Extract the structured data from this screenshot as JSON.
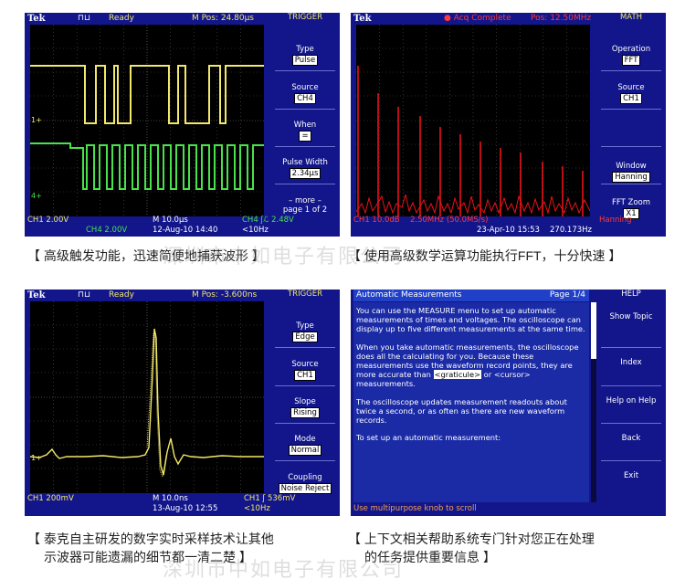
{
  "panels": {
    "trigger": {
      "brand": "Tek",
      "status": "Ready",
      "mpos": "M Pos: 24.80µs",
      "menu_title": "TRIGGER",
      "items": [
        {
          "label": "Type",
          "value": "Pulse"
        },
        {
          "label": "Source",
          "value": "CH4"
        },
        {
          "label": "When",
          "value": "="
        },
        {
          "label": "Pulse Width",
          "value": "2.34µs"
        },
        {
          "label": "– more –",
          "value": "page 1 of 2"
        }
      ],
      "readouts": {
        "ch1": "CH1  2.00V",
        "ch4": "CH4  2.00V",
        "time": "M 10.0µs",
        "date": "12-Aug-10 14:40",
        "trig": "CH4 ʃℒ 2.48V",
        "freq": "<10Hz"
      },
      "colors": {
        "ch1": "#f2e86a",
        "ch4": "#49e24a"
      }
    },
    "fft": {
      "brand": "Tek",
      "status": "Acq Complete",
      "pos": "Pos: 12.50MHz",
      "menu_title": "MATH",
      "items": [
        {
          "label": "Operation",
          "value": "FFT"
        },
        {
          "label": "Source",
          "value": "CH1"
        },
        {
          "label": "Window",
          "value": "Hanning"
        },
        {
          "label": "FFT Zoom",
          "value": "X1"
        }
      ],
      "readouts": {
        "scale": "CH1 10.0dB",
        "span": "2.50MHz (50.0MS/s)",
        "date": "23-Apr-10 15:53",
        "freq": "270.173Hz",
        "window": "Hanning"
      },
      "colors": {
        "math": "#e8121a"
      }
    },
    "edge": {
      "brand": "Tek",
      "status": "Ready",
      "mpos": "M Pos: -3.600ns",
      "menu_title": "TRIGGER",
      "items": [
        {
          "label": "Type",
          "value": "Edge"
        },
        {
          "label": "Source",
          "value": "CH1"
        },
        {
          "label": "Slope",
          "value": "Rising"
        },
        {
          "label": "Mode",
          "value": "Normal"
        },
        {
          "label": "Coupling",
          "value": "Noise Reject"
        }
      ],
      "readouts": {
        "ch1": "CH1  200mV",
        "time": "M 10.0ns",
        "date": "13-Aug-10 12:55",
        "trig": "CH1 ʃ 536mV",
        "freq": "<10Hz"
      }
    },
    "help": {
      "title": "Automatic Measurements",
      "page": "Page 1/4",
      "menu_title": "HELP",
      "items": [
        "Show Topic",
        "Index",
        "Help on Help",
        "Back",
        "Exit"
      ],
      "para1": "You can use the MEASURE menu to set up automatic measurements of times and voltages. The oscilloscope can display up to five different measurements at the same time.",
      "para2_a": "When you take automatic measurements, the oscilloscope does all the calculating for you. Because these measurements use the waveform record points, they are more accurate than ",
      "para2_link1": "<graticule>",
      "para2_mid": " or ",
      "para2_link2": "<cursor>",
      "para2_b": " measurements.",
      "para3": "The oscilloscope updates measurement readouts about twice a second, or as often as there are new waveform records.",
      "para4": "To set up an automatic measurement:",
      "footer": "Use multipurpose knob to scroll"
    }
  },
  "captions": {
    "c1": "【 高级触发功能，迅速简便地捕获波形 】",
    "c2": "【 使用高级数学运算功能执行FFT，十分快速 】",
    "c3_line1": "【 泰克自主研发的数字实时采样技术让其他",
    "c3_line2": "示波器可能遗漏的细节都一清二楚 】",
    "c4_line1": "【 上下文相关帮助系统专门针对您正在处理",
    "c4_line2": "的任务提供重要信息 】"
  },
  "watermark": "深圳市中如电子有限公司"
}
